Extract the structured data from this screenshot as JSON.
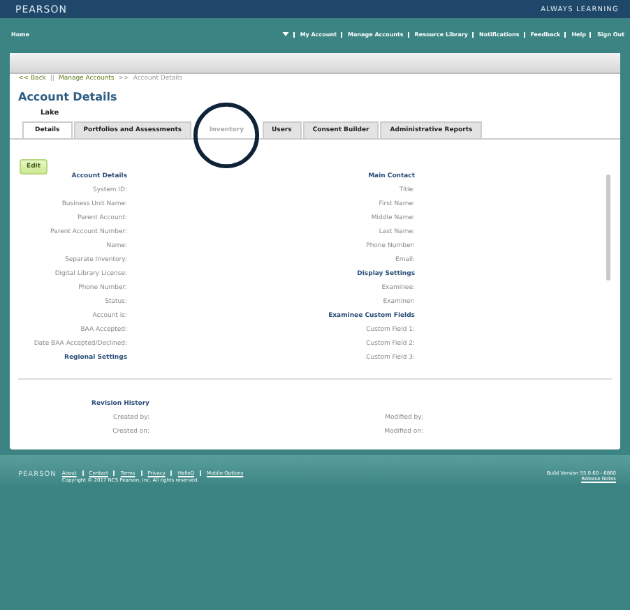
{
  "header": {
    "brand": "PEARSON",
    "tagline": "ALWAYS LEARNING"
  },
  "nav": {
    "home": "Home",
    "links": [
      "My Account",
      "Manage Accounts",
      "Resource Library",
      "Notifications",
      "Feedback",
      "Help",
      "Sign Out"
    ]
  },
  "breadcrumb": [
    {
      "kind": "link",
      "text": "<< Back"
    },
    {
      "kind": "sep",
      "text": "||"
    },
    {
      "kind": "link",
      "text": "Manage Accounts"
    },
    {
      "kind": "sep",
      "text": ">>"
    },
    {
      "kind": "current",
      "text": "Account Details"
    }
  ],
  "title": "Account Details",
  "account_name": "Lake",
  "tabs": [
    {
      "label": "Details",
      "selected": true,
      "disabled": false
    },
    {
      "label": "Portfolios and Assessments",
      "selected": false,
      "disabled": false
    },
    {
      "label": "Inventory",
      "selected": false,
      "disabled": true
    },
    {
      "label": "Users",
      "selected": false,
      "disabled": false
    },
    {
      "label": "Consent Builder",
      "selected": false,
      "disabled": false
    },
    {
      "label": "Administrative Reports",
      "selected": false,
      "disabled": false
    }
  ],
  "edit_button": "Edit",
  "left_column": [
    {
      "heading": "Account Details",
      "fields": [
        "System ID:",
        "Business Unit Name:",
        "Parent Account:",
        "Parent Account Number:",
        "Name:",
        "Separate Inventory:",
        "Digital Library License:",
        "Phone Number:",
        "Status:",
        "Account is:",
        "BAA Accepted:",
        "Date BAA Accepted/Declined:"
      ]
    },
    {
      "heading": "Regional Settings"
    }
  ],
  "right_column": [
    {
      "heading": "Main Contact",
      "fields": [
        "Title:",
        "First Name:",
        "Middle Name:",
        "Last Name:",
        "Phone Number:",
        "Email:"
      ]
    },
    {
      "heading": "Display Settings",
      "fields": [
        "Examinee:",
        "Examiner:"
      ]
    },
    {
      "heading": "Examinee Custom Fields",
      "fields": [
        "Custom Field 1:",
        "Custom Field 2:",
        "Custom Field 3:"
      ]
    }
  ],
  "revision_history": {
    "heading": "Revision History",
    "left": [
      "Created by:",
      "Created on:"
    ],
    "right": [
      "Modified by:",
      "Modified on:"
    ]
  },
  "footer": {
    "brand": "PEARSON",
    "links": [
      "About",
      "Contact",
      "Terms",
      "Privacy",
      "HelloQ",
      "Mobile Options"
    ],
    "copyright": "Copyright © 2017 NCS Pearson, Inc. All rights reserved.",
    "build": "Build Version 55.0.60 - 6860",
    "release_notes": "Release Notes"
  }
}
